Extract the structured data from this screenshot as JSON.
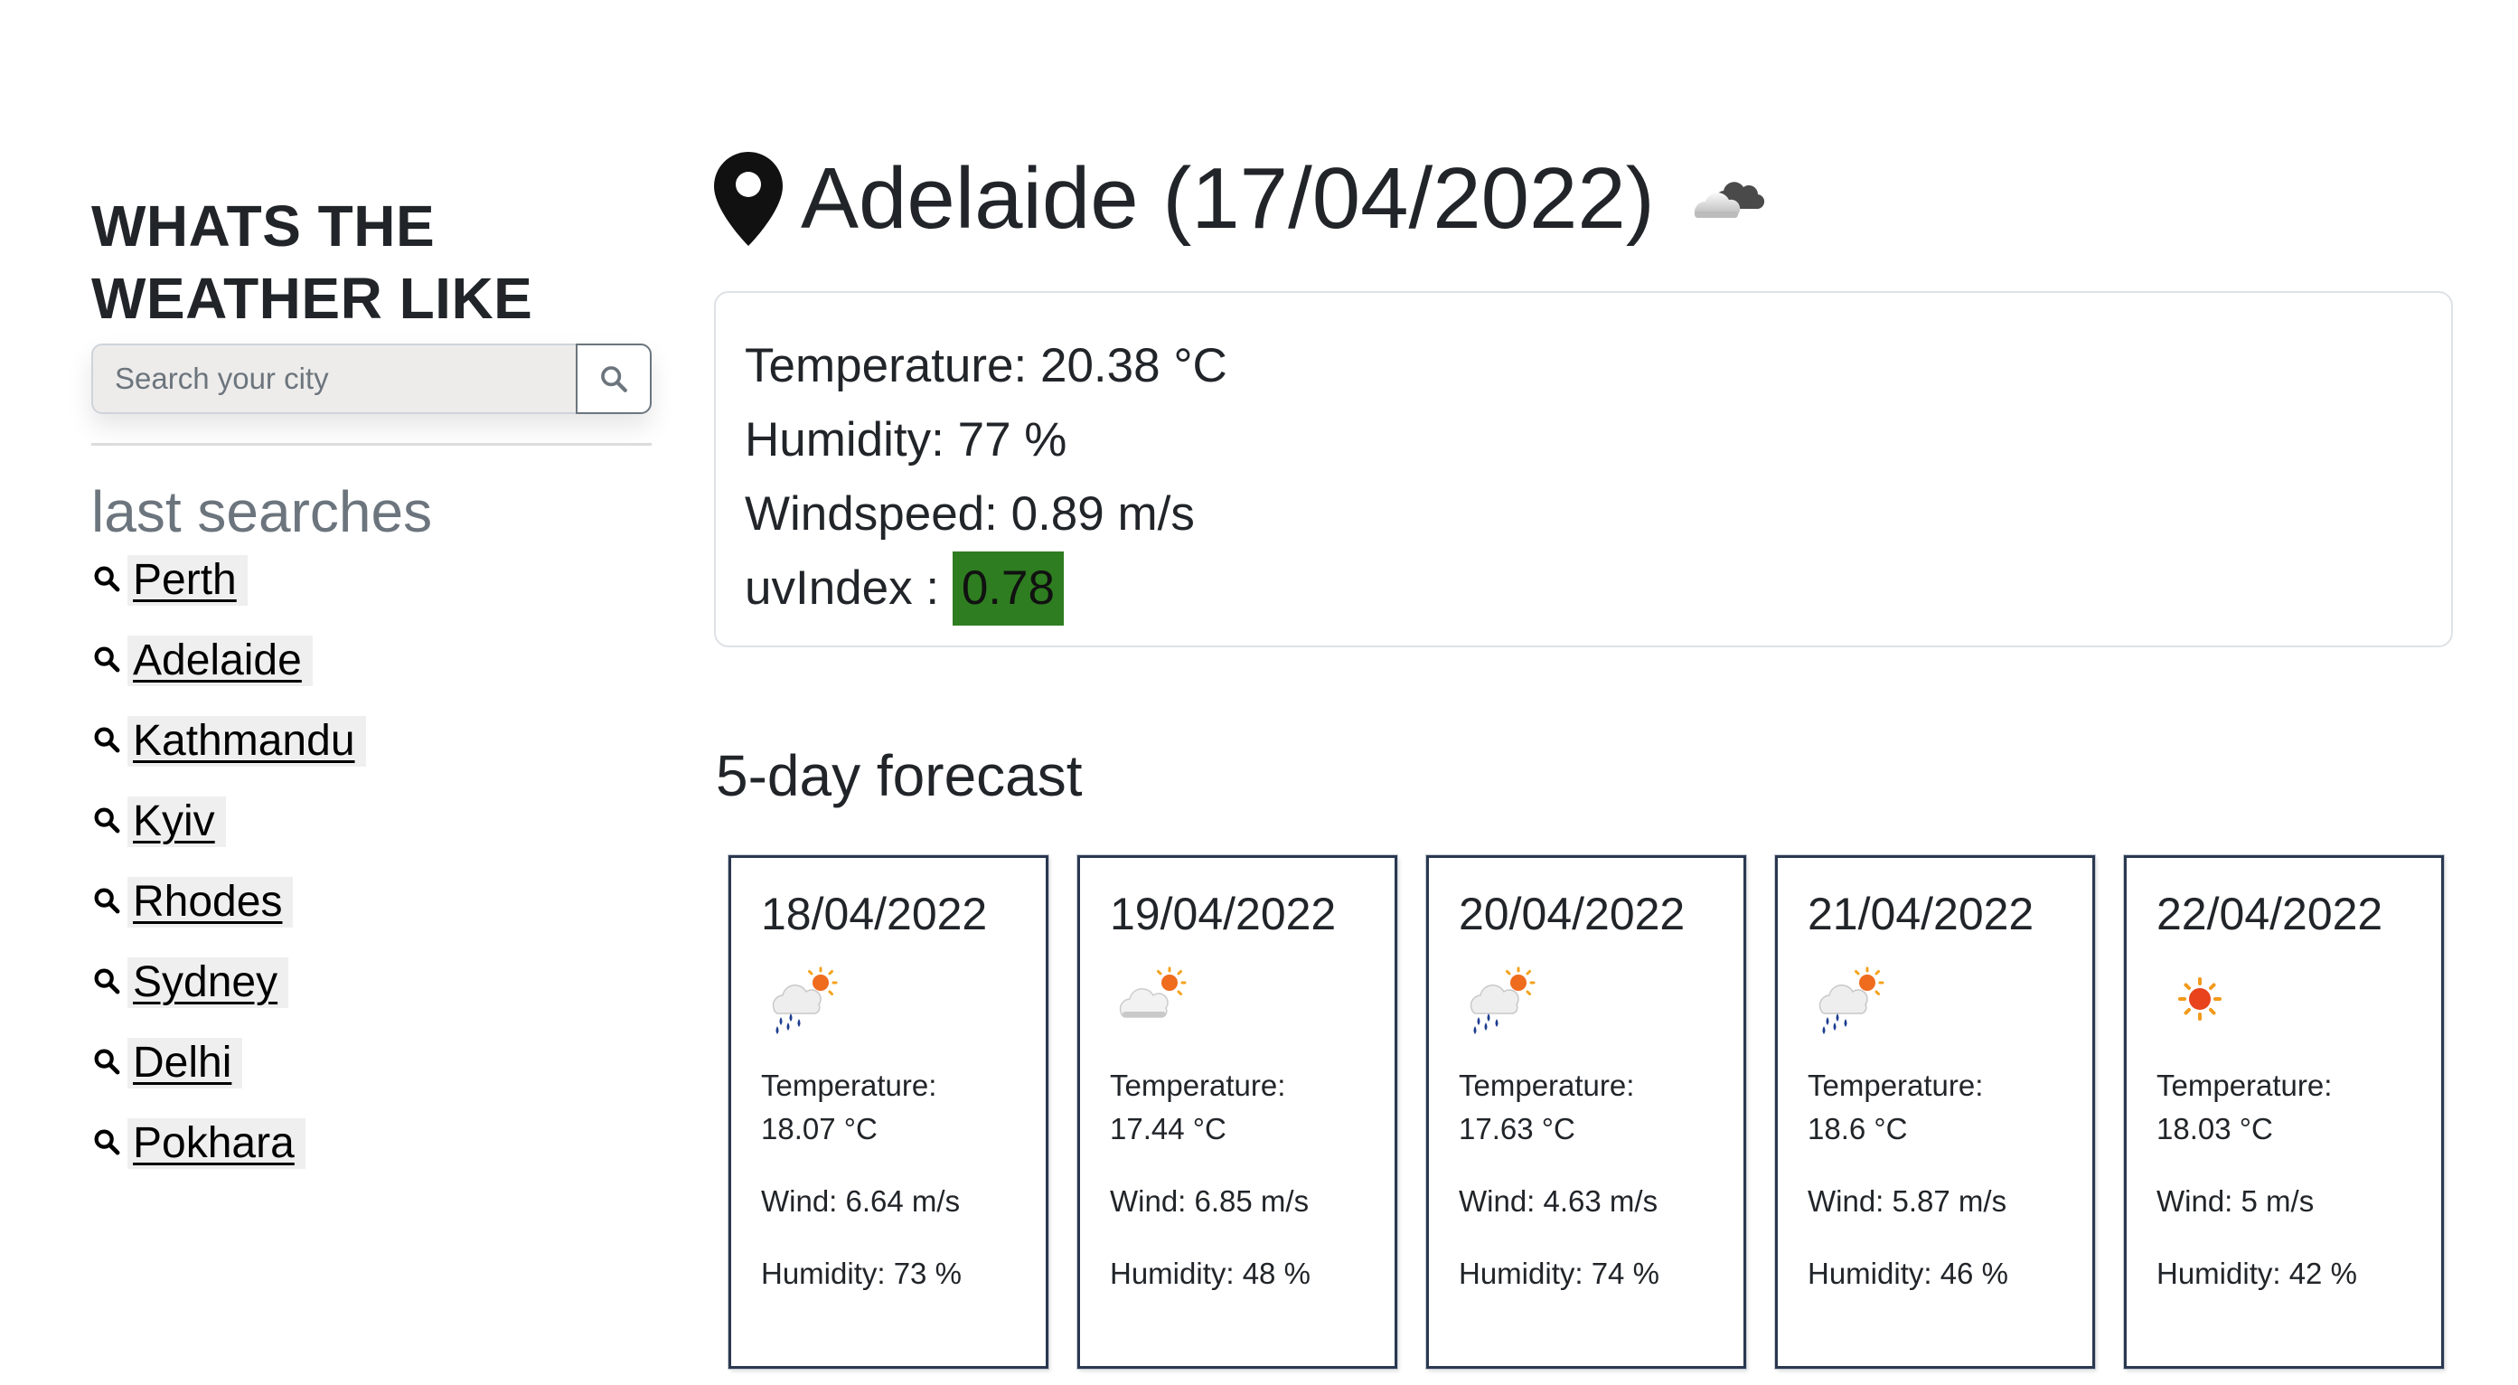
{
  "app": {
    "title_line1": "WHATS THE",
    "title_line2": "WEATHER LIKE"
  },
  "search": {
    "placeholder": "Search your city",
    "value": "",
    "button_icon": "search-icon"
  },
  "history": {
    "heading": "last searches",
    "items": [
      {
        "label": "Perth"
      },
      {
        "label": "Adelaide"
      },
      {
        "label": "Kathmandu"
      },
      {
        "label": "Kyiv"
      },
      {
        "label": "Rhodes"
      },
      {
        "label": "Sydney"
      },
      {
        "label": "Delhi"
      },
      {
        "label": "Pokhara"
      }
    ]
  },
  "current": {
    "title": "Adelaide (17/04/2022)",
    "icon": "broken-clouds-icon",
    "temperature": "Temperature: 20.38 °C",
    "humidity": "Humidity: 77 %",
    "windspeed": "Windspeed: 0.89 m/s",
    "uv_label": "uvIndex : ",
    "uv_value": "0.78",
    "uv_color": "#2e7d20"
  },
  "forecast": {
    "heading": "5-day forecast",
    "days": [
      {
        "date": "18/04/2022",
        "icon": "rain-sun-icon",
        "temp_label": "Temperature:",
        "temp_value": "18.07 °C",
        "wind": "Wind: 6.64 m/s",
        "humidity": "Humidity: 73 %"
      },
      {
        "date": "19/04/2022",
        "icon": "cloud-sun-icon",
        "temp_label": "Temperature:",
        "temp_value": "17.44 °C",
        "wind": "Wind: 6.85 m/s",
        "humidity": "Humidity: 48 %"
      },
      {
        "date": "20/04/2022",
        "icon": "rain-sun-icon",
        "temp_label": "Temperature:",
        "temp_value": "17.63 °C",
        "wind": "Wind: 4.63 m/s",
        "humidity": "Humidity: 74 %"
      },
      {
        "date": "21/04/2022",
        "icon": "rain-sun-icon",
        "temp_label": "Temperature:",
        "temp_value": "18.6 °C",
        "wind": "Wind: 5.87 m/s",
        "humidity": "Humidity: 46 %"
      },
      {
        "date": "22/04/2022",
        "icon": "sun-icon",
        "temp_label": "Temperature:",
        "temp_value": "18.03 °C",
        "wind": "Wind: 5 m/s",
        "humidity": "Humidity: 42 %"
      }
    ]
  }
}
